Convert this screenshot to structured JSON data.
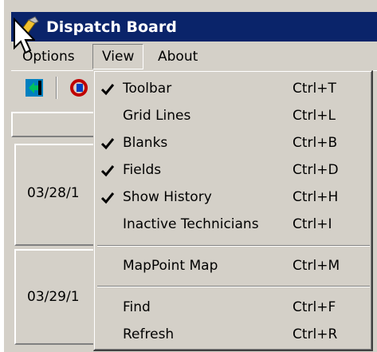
{
  "window": {
    "title": "Dispatch Board"
  },
  "menubar": {
    "items": [
      "Options",
      "View",
      "About"
    ]
  },
  "grid": {
    "dates": [
      "03/28/1",
      "03/29/1"
    ]
  },
  "view_menu": {
    "items": [
      {
        "label": "Toolbar",
        "accel": "Ctrl+T",
        "checked": true
      },
      {
        "label": "Grid Lines",
        "accel": "Ctrl+L",
        "checked": false
      },
      {
        "label": "Blanks",
        "accel": "Ctrl+B",
        "checked": true
      },
      {
        "label": "Fields",
        "accel": "Ctrl+D",
        "checked": true
      },
      {
        "label": "Show History",
        "accel": "Ctrl+H",
        "checked": true
      },
      {
        "label": "Inactive Technicians",
        "accel": "Ctrl+I",
        "checked": false
      },
      {
        "label": "MapPoint Map",
        "accel": "Ctrl+M",
        "checked": false
      },
      {
        "label": "Find",
        "accel": "Ctrl+F",
        "checked": false
      },
      {
        "label": "Refresh",
        "accel": "Ctrl+R",
        "checked": false
      }
    ]
  },
  "icons": [
    "app-icon",
    "import-icon",
    "refresh-icon",
    "check-icon",
    "mouse-cursor-icon"
  ],
  "colors": {
    "titlebar": "#0a246a",
    "face": "#d4d0c8"
  }
}
